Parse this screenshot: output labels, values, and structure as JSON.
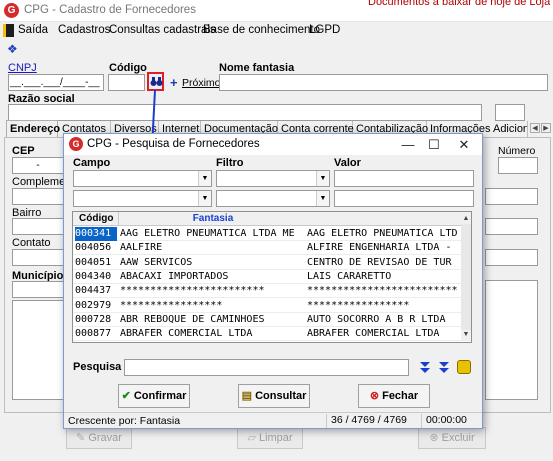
{
  "main_window": {
    "title": "CPG - Cadastro de Fornecedores",
    "logo_letter": "G",
    "background_text": "Documentos a baixar de hoje de Loja"
  },
  "menu": [
    {
      "label": "Saída",
      "icon": "exit-icon"
    },
    {
      "label": "Cadastros"
    },
    {
      "label": "Consultas cadastrais"
    },
    {
      "label": "Base de conhecimento"
    },
    {
      "label": "LGPD"
    }
  ],
  "form": {
    "cnpj_label": "CNPJ",
    "cnpj_value": "__.___.___/____-__",
    "codigo_label": "Código",
    "proximo_label": "Próximo",
    "nome_fantasia_label": "Nome fantasia",
    "razao_social_label": "Razão social",
    "cep_label": "CEP",
    "cep_value": "-",
    "complemento_label": "Complemento",
    "bairro_label": "Bairro",
    "contato_label": "Contato",
    "municipio_label": "Município",
    "numero_label": "Número"
  },
  "tabs": [
    "Endereço",
    "Contatos",
    "Diversos",
    "Internet",
    "Documentação",
    "Conta corrente",
    "Contabilização",
    "Informações Adiciona"
  ],
  "bottom_buttons": {
    "gravar": "Gravar",
    "limpar": "Limpar",
    "excluir": "Excluir"
  },
  "dialog": {
    "title": "CPG - Pesquisa de Fornecedores",
    "logo_letter": "G",
    "campo_label": "Campo",
    "filtro_label": "Filtro",
    "valor_label": "Valor",
    "grid_columns": [
      "Código",
      "Fantasia",
      ""
    ],
    "rows": [
      {
        "codigo": "000341",
        "fantasia": "AAG ELETRO PNEUMATICA LTDA ME",
        "razao": "AAG ELETRO PNEUMATICA LTD",
        "selected": true
      },
      {
        "codigo": "004056",
        "fantasia": "AALFIRE",
        "razao": "ALFIRE ENGENHARIA LTDA -"
      },
      {
        "codigo": "004051",
        "fantasia": "AAW SERVICOS",
        "razao": "CENTRO DE REVISAO DE TUR"
      },
      {
        "codigo": "004340",
        "fantasia": "ABACAXI IMPORTADOS",
        "razao": "LAIS CARARETTO"
      },
      {
        "codigo": "004437",
        "fantasia": "************************",
        "razao": "*************************"
      },
      {
        "codigo": "002979",
        "fantasia": "*****************",
        "razao": "*****************"
      },
      {
        "codigo": "000728",
        "fantasia": "ABR REBOQUE DE CAMINHOES",
        "razao": "AUTO SOCORRO A B R LTDA"
      },
      {
        "codigo": "000877",
        "fantasia": "ABRAFER COMERCIAL LTDA",
        "razao": "ABRAFER COMERCIAL LTDA"
      }
    ],
    "pesquisa_label": "Pesquisa",
    "confirmar_label": "Confirmar",
    "consultar_label": "Consultar",
    "fechar_label": "Fechar",
    "status": {
      "sort": "Crescente por: Fantasia",
      "count": "36 / 4769 / 4769",
      "time": "00:00:00"
    }
  },
  "colors": {
    "selection": "#0a64c8",
    "annotation": "#e02020",
    "arrow": "#1a3fd0"
  }
}
